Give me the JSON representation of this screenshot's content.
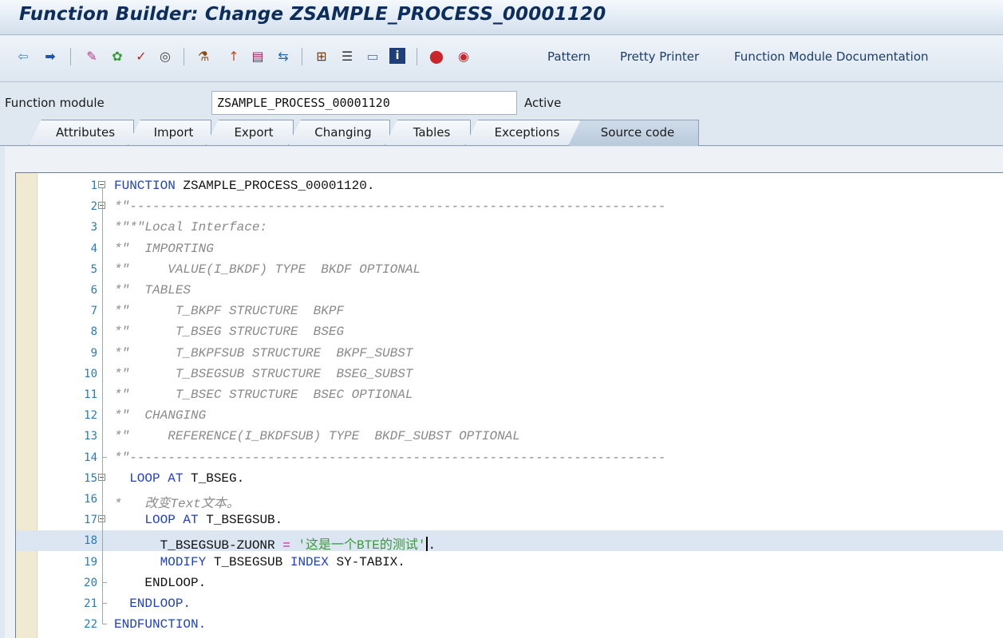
{
  "window": {
    "title": "Function Builder: Change ZSAMPLE_PROCESS_00001120"
  },
  "toolbar": {
    "icons": [
      "back-arrow-icon",
      "forward-arrow-icon",
      "toggle-display-change-icon",
      "other-object-icon",
      "check-icon",
      "activate-icon",
      "test-icon",
      "where-used-icon",
      "display-object-list-icon",
      "navigate-icon",
      "hierarchy-icon",
      "stack-icon",
      "window-icon",
      "info-icon",
      "breakpoint-icon",
      "external-breakpoint-icon"
    ],
    "pattern_label": "Pattern",
    "pretty_printer_label": "Pretty Printer",
    "documentation_label": "Function Module Documentation"
  },
  "form": {
    "label": "Function module",
    "value": "ZSAMPLE_PROCESS_00001120",
    "status": "Active"
  },
  "tabs": [
    {
      "label": "Attributes",
      "active": false
    },
    {
      "label": "Import",
      "active": false
    },
    {
      "label": "Export",
      "active": false
    },
    {
      "label": "Changing",
      "active": false
    },
    {
      "label": "Tables",
      "active": false
    },
    {
      "label": "Exceptions",
      "active": false
    },
    {
      "label": "Source code",
      "active": true
    }
  ],
  "code": {
    "cursor_line": 18,
    "lines": [
      {
        "n": "1",
        "tokens": [
          [
            "kw",
            "FUNCTION"
          ],
          [
            "id",
            " ZSAMPLE_PROCESS_00001120."
          ]
        ]
      },
      {
        "n": "2",
        "tokens": [
          [
            "cm",
            "*\"----------------------------------------------------------------------"
          ]
        ]
      },
      {
        "n": "3",
        "tokens": [
          [
            "cm",
            "*\"*\"Local Interface:"
          ]
        ]
      },
      {
        "n": "4",
        "tokens": [
          [
            "cm",
            "*\"  IMPORTING"
          ]
        ]
      },
      {
        "n": "5",
        "tokens": [
          [
            "cm",
            "*\"     VALUE(I_BKDF) TYPE  BKDF OPTIONAL"
          ]
        ]
      },
      {
        "n": "6",
        "tokens": [
          [
            "cm",
            "*\"  TABLES"
          ]
        ]
      },
      {
        "n": "7",
        "tokens": [
          [
            "cm",
            "*\"      T_BKPF STRUCTURE  BKPF"
          ]
        ]
      },
      {
        "n": "8",
        "tokens": [
          [
            "cm",
            "*\"      T_BSEG STRUCTURE  BSEG"
          ]
        ]
      },
      {
        "n": "9",
        "tokens": [
          [
            "cm",
            "*\"      T_BKPFSUB STRUCTURE  BKPF_SUBST"
          ]
        ]
      },
      {
        "n": "10",
        "tokens": [
          [
            "cm",
            "*\"      T_BSEGSUB STRUCTURE  BSEG_SUBST"
          ]
        ]
      },
      {
        "n": "11",
        "tokens": [
          [
            "cm",
            "*\"      T_BSEC STRUCTURE  BSEC OPTIONAL"
          ]
        ]
      },
      {
        "n": "12",
        "tokens": [
          [
            "cm",
            "*\"  CHANGING"
          ]
        ]
      },
      {
        "n": "13",
        "tokens": [
          [
            "cm",
            "*\"     REFERENCE(I_BKDFSUB) TYPE  BKDF_SUBST OPTIONAL"
          ]
        ]
      },
      {
        "n": "14",
        "tokens": [
          [
            "cm",
            "*\"----------------------------------------------------------------------"
          ]
        ]
      },
      {
        "n": "15",
        "tokens": [
          [
            "id",
            "  "
          ],
          [
            "kw",
            "LOOP AT"
          ],
          [
            "id",
            " T_BSEG."
          ]
        ]
      },
      {
        "n": "16",
        "tokens": [
          [
            "cm",
            "*   改变Text文本。"
          ]
        ]
      },
      {
        "n": "17",
        "tokens": [
          [
            "id",
            "    "
          ],
          [
            "kw",
            "LOOP AT"
          ],
          [
            "id",
            " T_BSEGSUB."
          ]
        ]
      },
      {
        "n": "18",
        "tokens": [
          [
            "id",
            "      T_BSEGSUB-ZUONR "
          ],
          [
            "op",
            "="
          ],
          [
            "id",
            " "
          ],
          [
            "str",
            "'这是一个BTE的测试'"
          ],
          [
            "caret",
            ""
          ],
          [
            "id",
            "."
          ]
        ]
      },
      {
        "n": "19",
        "tokens": [
          [
            "id",
            "      "
          ],
          [
            "kw",
            "MODIFY"
          ],
          [
            "id",
            " T_BSEGSUB "
          ],
          [
            "kw",
            "INDEX"
          ],
          [
            "id",
            " SY-TABIX."
          ]
        ]
      },
      {
        "n": "20",
        "tokens": [
          [
            "id",
            "    ENDLOOP."
          ]
        ]
      },
      {
        "n": "21",
        "tokens": [
          [
            "id",
            "  "
          ],
          [
            "kw",
            "ENDLOOP."
          ]
        ]
      },
      {
        "n": "22",
        "tokens": [
          [
            "kw",
            "ENDFUNCTION."
          ]
        ]
      }
    ]
  }
}
